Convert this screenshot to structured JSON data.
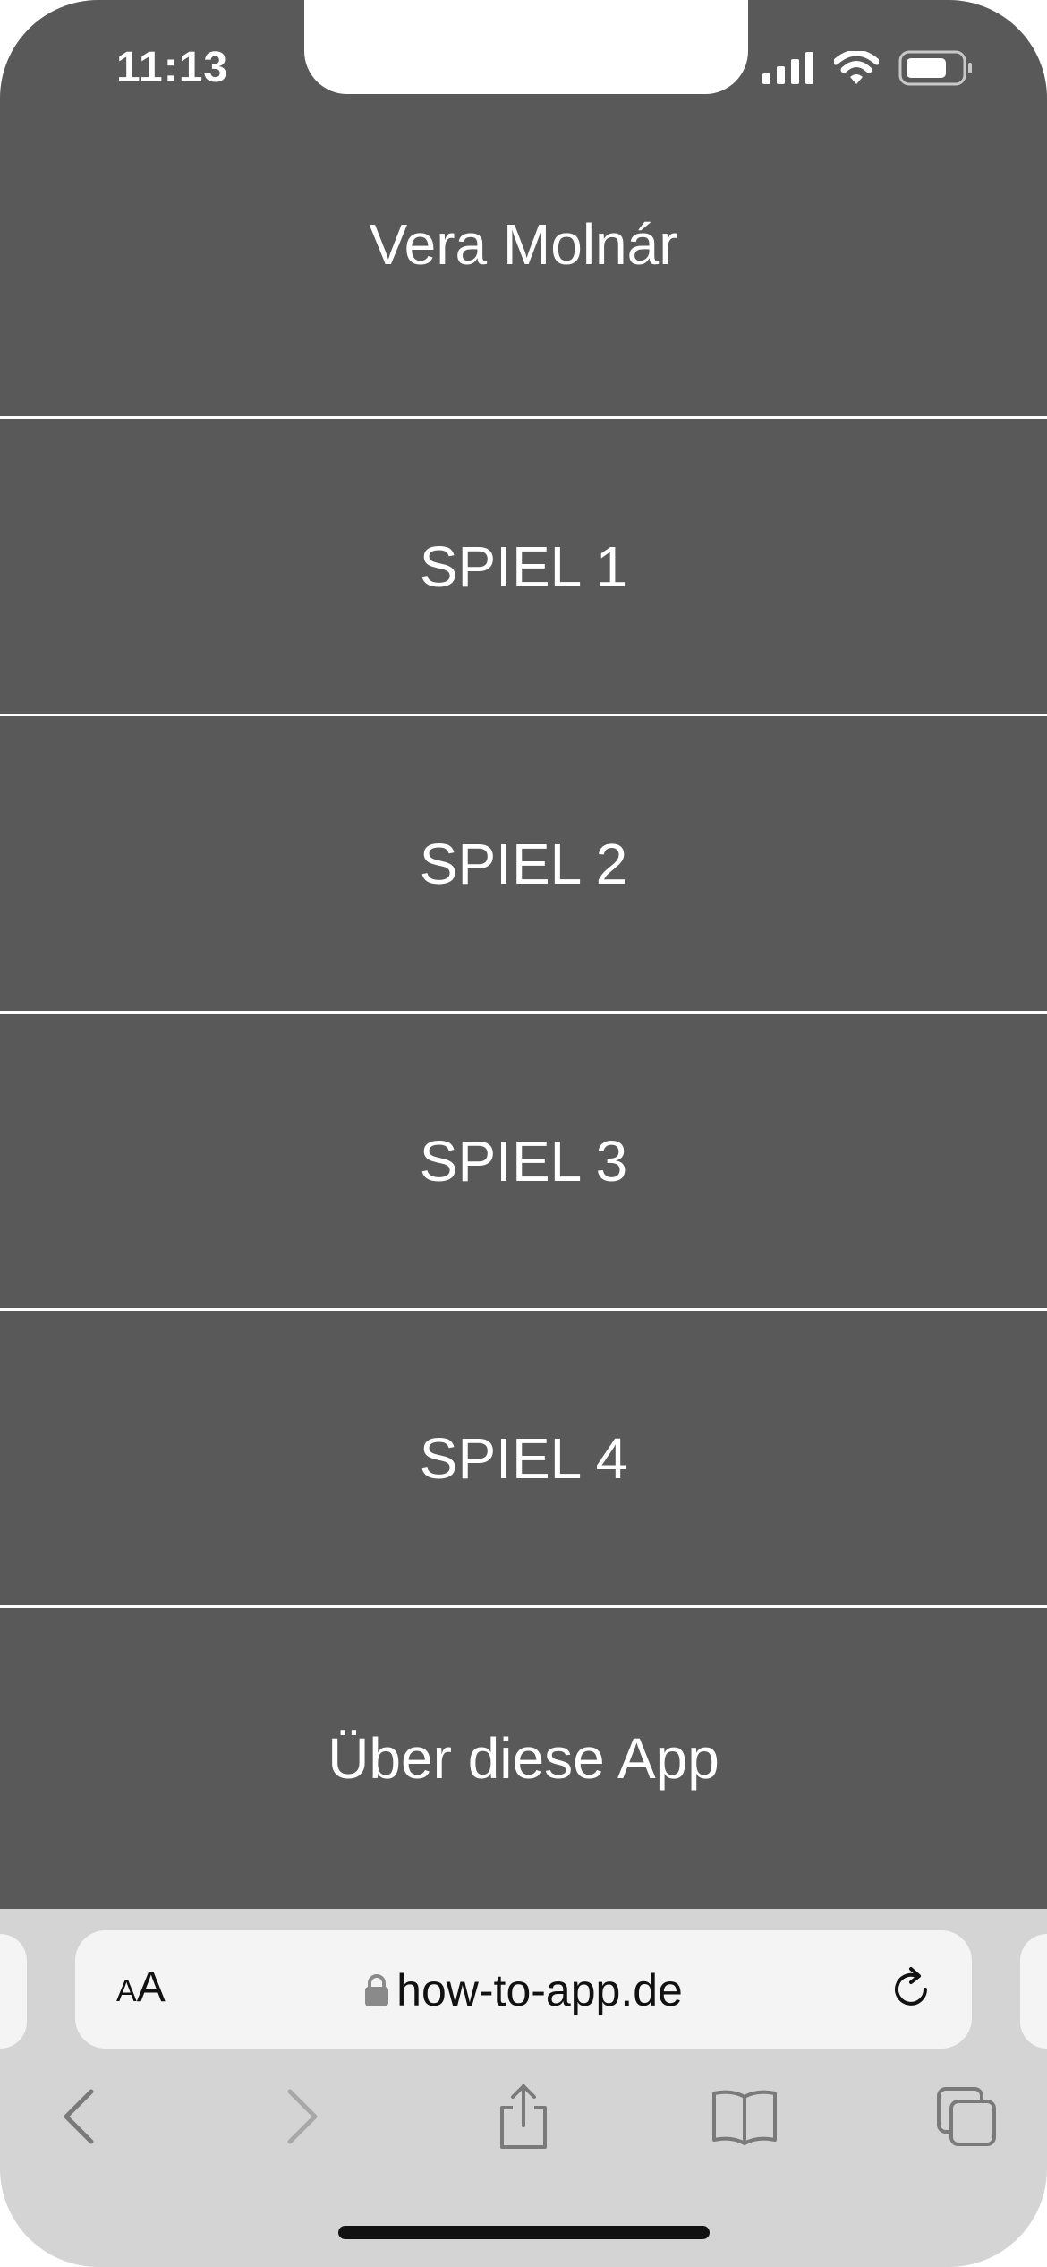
{
  "status_bar": {
    "time": "11:13"
  },
  "menu": {
    "items": [
      {
        "label": "Vera Molnár"
      },
      {
        "label": "SPIEL 1"
      },
      {
        "label": "SPIEL 2"
      },
      {
        "label": "SPIEL 3"
      },
      {
        "label": "SPIEL 4"
      },
      {
        "label": "Über diese App"
      }
    ]
  },
  "browser": {
    "aa_small": "A",
    "aa_large": "A",
    "url": "how-to-app.de",
    "icons": {
      "lock": "lock-icon",
      "reload": "reload-icon",
      "back": "chevron-left-icon",
      "forward": "chevron-right-icon",
      "share": "share-icon",
      "bookmarks": "book-icon",
      "tabs": "tabs-icon"
    }
  },
  "colors": {
    "menu_background": "#595959",
    "menu_text": "#ffffff",
    "chrome_background": "#d4d4d4",
    "url_bar_background": "#f4f4f4"
  }
}
